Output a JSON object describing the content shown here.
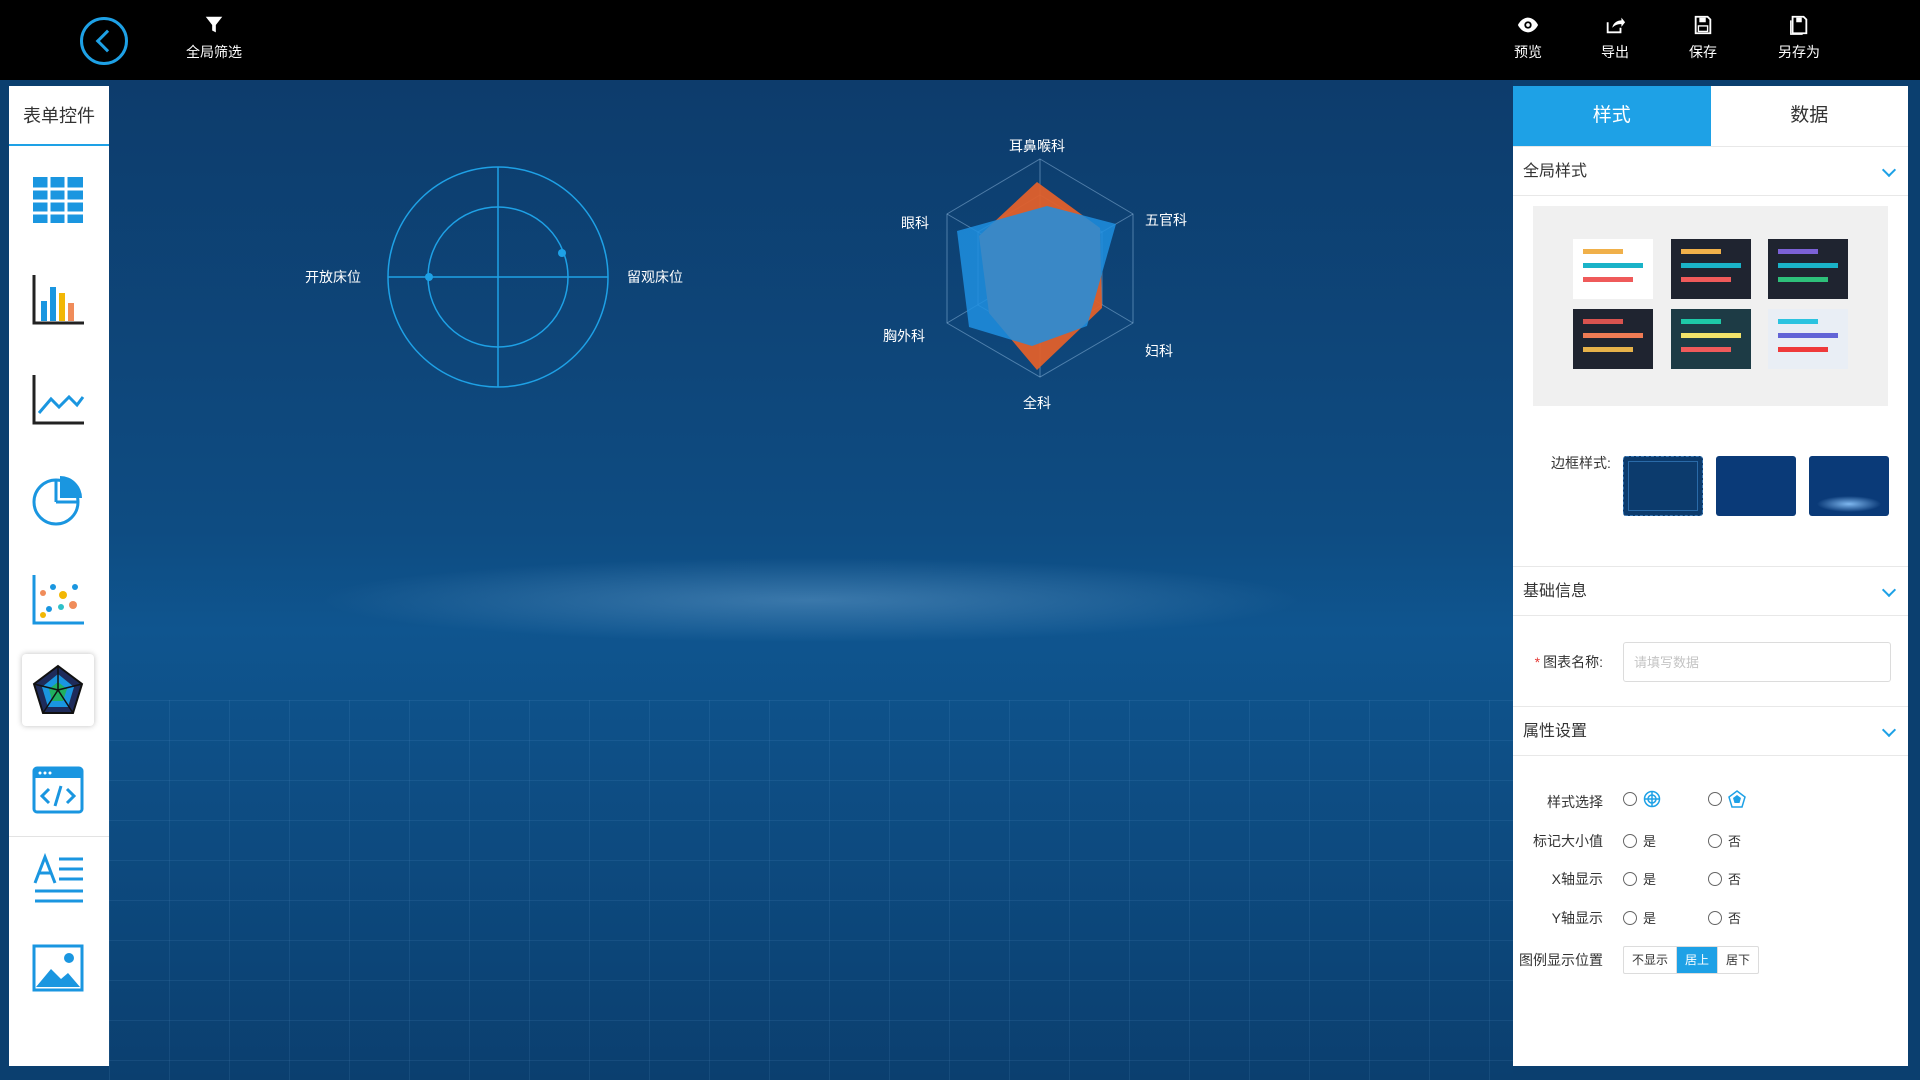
{
  "toolbar": {
    "filter_label": "全局筛选",
    "preview_label": "预览",
    "export_label": "导出",
    "save_label": "保存",
    "saveas_label": "另存为"
  },
  "palette": {
    "title": "表单控件",
    "items": [
      "table-icon",
      "bar-chart-icon",
      "line-chart-icon",
      "pie-chart-icon",
      "scatter-chart-icon",
      "radar-chart-icon",
      "code-icon",
      "text-icon",
      "image-icon"
    ],
    "active": "radar-chart-icon"
  },
  "canvas": {
    "polar_labels": {
      "left": "开放床位",
      "right": "留观床位"
    },
    "radar_labels": [
      "耳鼻喉科",
      "五官科",
      "妇科",
      "全科",
      "胸外科",
      "眼科"
    ],
    "series_colors": [
      "#e0602b",
      "#1e8fe0"
    ]
  },
  "panel": {
    "tabs": [
      "样式",
      "数据"
    ],
    "active_tab": "样式",
    "global_style": {
      "title": "全局样式",
      "themes": [
        {
          "bg": "#ffffff",
          "bars": [
            "#f0b04a",
            "#1ab3c8",
            "#ef5a5a"
          ]
        },
        {
          "bg": "#1f2430",
          "bars": [
            "#f0b04a",
            "#1ab3c8",
            "#ef5a5a"
          ]
        },
        {
          "bg": "#1f2430",
          "bars": [
            "#7b61d6",
            "#1ab3c8",
            "#2ec07a"
          ]
        },
        {
          "bg": "#1f2430",
          "bars": [
            "#d9534f",
            "#ef7b54",
            "#e6b24a"
          ]
        },
        {
          "bg": "#1d3b45",
          "bars": [
            "#1ec9a7",
            "#f2e36a",
            "#ef5a5a"
          ]
        },
        {
          "bg": "#e9eef5",
          "bars": [
            "#2bc3e0",
            "#6264d6",
            "#ef3a3a"
          ]
        }
      ],
      "border_label": "边框样式:"
    },
    "basic_info": {
      "title": "基础信息",
      "name_label": "图表名称:",
      "name_placeholder": "请填写数据"
    },
    "attributes": {
      "title": "属性设置",
      "style_select_label": "样式选择",
      "mark_label": "标记大小值",
      "xaxis_label": "X轴显示",
      "yaxis_label": "Y轴显示",
      "yes": "是",
      "no": "否",
      "legend_label": "图例显示位置",
      "legend_options": [
        "不显示",
        "居上",
        "居下"
      ],
      "legend_active": "居上"
    }
  }
}
